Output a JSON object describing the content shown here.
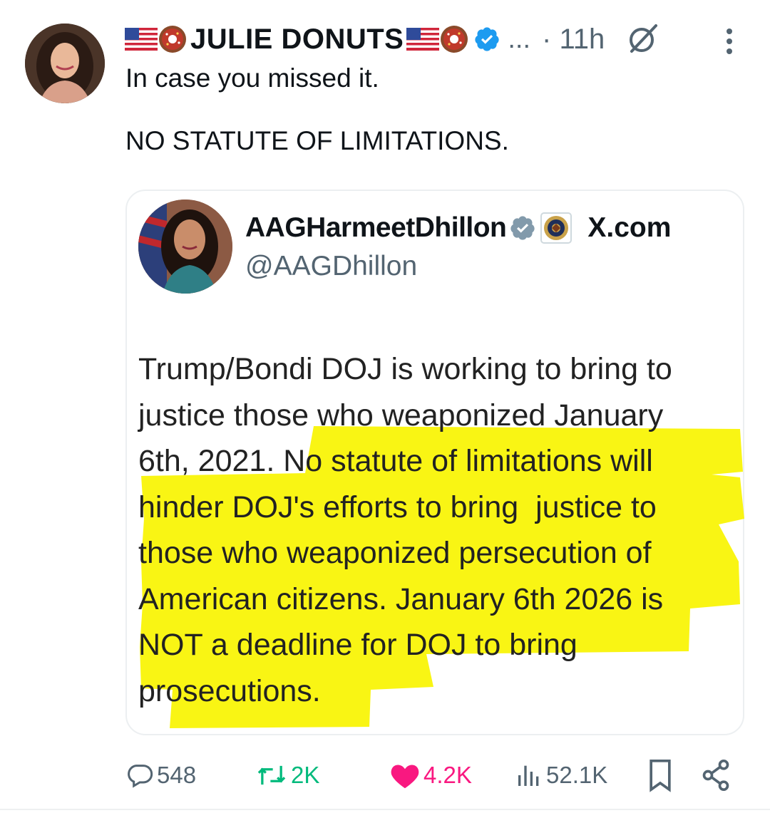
{
  "author": {
    "display_name": "JULIE DONUTS",
    "more_label": "...",
    "time": "· 11h"
  },
  "tweet": {
    "text": "In case you missed it.\n\nNO STATUTE OF LIMITATIONS."
  },
  "quoted": {
    "display_name": "AAGHarmeetDhillon",
    "site": "X.com",
    "handle": "@AAGDhillon",
    "body": "Trump/Bondi DOJ is working to bring to\njustice those who weaponized January\n6th, 2021. No statute of limitations will\nhinder DOJ's efforts to bring  justice to\nthose who weaponized persecution of\nAmerican citizens. January 6th 2026 is\nNOT a deadline for DOJ to bring\nprosecutions."
  },
  "actions": {
    "replies": "548",
    "reposts": "2K",
    "likes": "4.2K",
    "views": "52.1K"
  },
  "colors": {
    "like": "#f91880",
    "repost": "#00ba7c",
    "verified": "#1d9bf0",
    "highlight": "#f8f400",
    "muted": "#536471"
  },
  "icons": [
    "us-flag-icon",
    "donut-icon",
    "verified-badge-icon",
    "grok-icon",
    "more-options-icon",
    "gray-verified-badge-icon",
    "doj-seal-icon",
    "reply-icon",
    "repost-icon",
    "like-icon",
    "views-icon",
    "bookmark-icon",
    "share-icon"
  ]
}
